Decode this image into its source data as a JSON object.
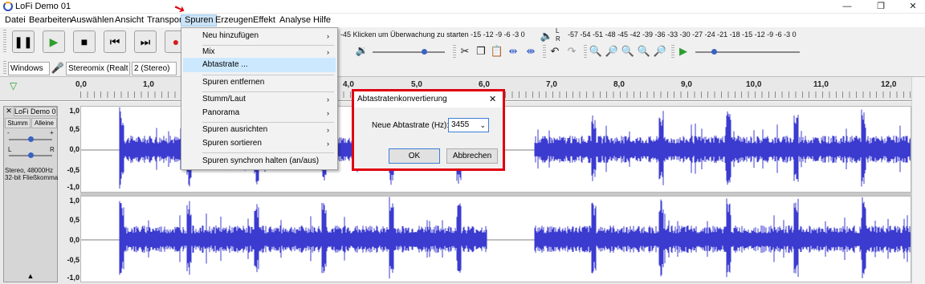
{
  "window": {
    "title": "LoFi Demo 01",
    "minimize": "—",
    "restore": "❐",
    "close": "✕"
  },
  "menubar": [
    "Datei",
    "Bearbeiten",
    "Auswählen",
    "Ansicht",
    "Transport",
    "Spuren",
    "Erzeugen",
    "Effekt",
    "Analyse",
    "Hilfe"
  ],
  "toolbar": {
    "rec_meter_ticks": "-45 Klicken um Überwachung zu starten -15 -12 -9 -6 -3 0",
    "play_meter_ticks": "-57 -54 -51 -48 -45 -42 -39 -36 -33 -30 -27 -24 -21 -18 -15 -12 -9 -6 -3 0",
    "meter_rec_L": "L",
    "meter_rec_R": "R",
    "meter_play_L": "L",
    "meter_play_R": "R",
    "host": "Windows",
    "input_device": "Stereomix (Realt",
    "channels": "2 (Stereo)"
  },
  "ruler": [
    "0,0",
    "1,0",
    "4,0",
    "5,0",
    "6,0",
    "7,0",
    "8,0",
    "9,0",
    "10,0",
    "11,0",
    "12,0"
  ],
  "track": {
    "name": "LoFi Demo 0",
    "close": "✕",
    "mute": "Stumm",
    "solo": "Alleine",
    "gain_minus": "-",
    "gain_plus": "+",
    "pan_l": "L",
    "pan_r": "R",
    "info1": "Stereo, 48000Hz",
    "info2": "32-bit Fließkomma",
    "collapse": "▲"
  },
  "scale_top": [
    "1,0",
    "0,5",
    "0,0",
    "-0,5",
    "-1,0"
  ],
  "scale_bottom": [
    "1,0",
    "0,5",
    "0,0",
    "-0,5",
    "-1,0"
  ],
  "menu": {
    "items": [
      "Neu hinzufügen",
      "Mix",
      "Abtastrate ...",
      "Spuren entfernen",
      "Stumm/Laut",
      "Panorama",
      "Spuren ausrichten",
      "Spuren sortieren",
      "Spuren synchron halten (an/aus)"
    ],
    "submenu_marker": "›"
  },
  "dialog": {
    "title": "Abtastratenkonvertierung",
    "close": "✕",
    "label": "Neue Abtastrate (Hz):",
    "value": "3455",
    "ok": "OK",
    "cancel": "Abbrechen"
  },
  "colors": {
    "wave": "#3b3bd0",
    "highlight_box": "#e00010",
    "menu_highlight": "#cce8ff"
  }
}
